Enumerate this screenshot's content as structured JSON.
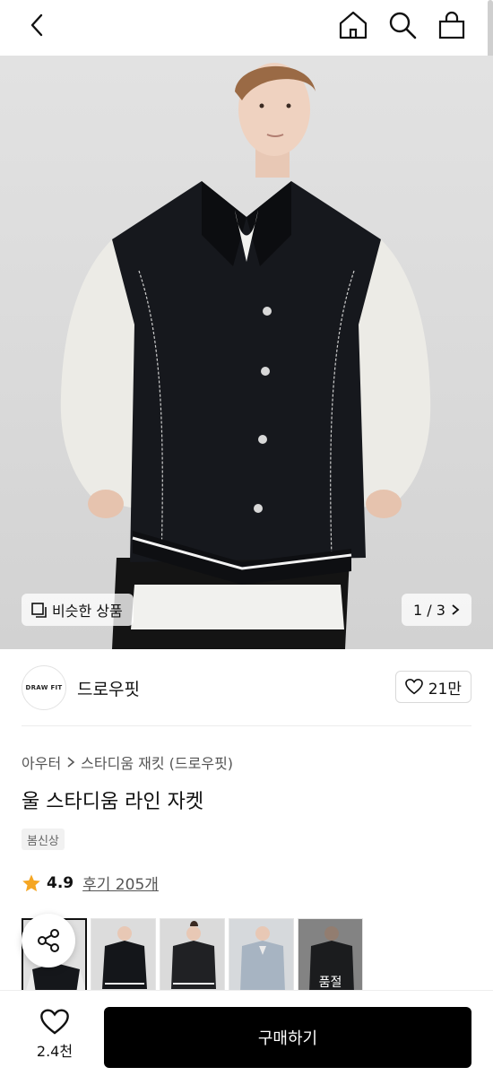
{
  "header": {
    "back_icon": "chevron-left-icon",
    "home_icon": "home-icon",
    "search_icon": "search-icon",
    "cart_icon": "shopping-bag-icon"
  },
  "hero": {
    "similar_label": "비슷한 상품",
    "pager_label": "1 / 3"
  },
  "brand": {
    "logo_text": "DRAW FIT",
    "name": "드로우핏",
    "likes": "21만"
  },
  "product": {
    "breadcrumb": [
      "아우터",
      "스타디움 재킷 (드로우핏)"
    ],
    "title": "울 스타디움 라인 자켓",
    "tag": "봄신상",
    "rating": "4.9",
    "reviews": "후기 205개",
    "accent_color": "#f5a623"
  },
  "thumbnails": [
    {
      "label": "",
      "active": true
    },
    {
      "label": "",
      "active": false
    },
    {
      "label": "",
      "active": false
    },
    {
      "label": "",
      "active": false
    },
    {
      "label": "품절",
      "active": false
    }
  ],
  "bottom": {
    "wish_count": "2.4천",
    "buy_label": "구매하기"
  }
}
